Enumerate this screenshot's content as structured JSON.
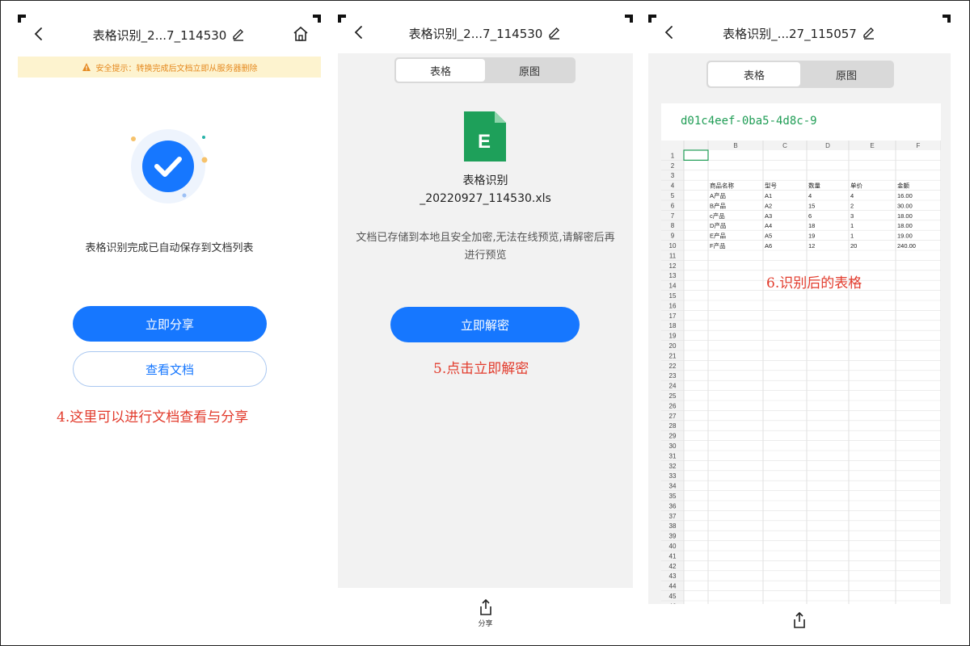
{
  "colors": {
    "accent": "#1677ff",
    "warning": "#e58a20",
    "warning_bg": "#fdf3cf",
    "annotation": "#e23b2c",
    "excel_green": "#1f9d55"
  },
  "panel1": {
    "title": "表格识别_2...7_114530",
    "warning": "安全提示：转换完成后文档立即从服务器删除",
    "success_text": "表格识别完成已自动保存到文档列表",
    "share_button": "立即分享",
    "view_button": "查看文档",
    "annotation": "4.这里可以进行文档查看与分享"
  },
  "panel2": {
    "title": "表格识别_2...7_114530",
    "tabs": [
      "表格",
      "原图"
    ],
    "file_icon_letter": "E",
    "file_name_line1": "表格识别",
    "file_name_line2": "_20220927_114530.xls",
    "encrypted_note": "文档已存储到本地且安全加密,无法在线预览,请解密后再进行预览",
    "decrypt_button": "立即解密",
    "annotation": "5.点击立即解密",
    "share_label": "分享"
  },
  "panel3": {
    "title": "表格识别_...27_115057",
    "tabs": [
      "表格",
      "原图"
    ],
    "sheet_name": "d01c4eef-0ba5-4d8c-9",
    "annotation": "6.识别后的表格",
    "columns": [
      "",
      "B",
      "C",
      "D",
      "E",
      "F"
    ],
    "row_count": 46,
    "rows": [
      {
        "row": 4,
        "cells": [
          "商品名称",
          "型号",
          "数量",
          "单价",
          "金额"
        ]
      },
      {
        "row": 5,
        "cells": [
          "A产品",
          "A1",
          "4",
          "4",
          "16.00"
        ]
      },
      {
        "row": 6,
        "cells": [
          "B产品",
          "A2",
          "15",
          "2",
          "30.00"
        ]
      },
      {
        "row": 7,
        "cells": [
          "c产品",
          "A3",
          "6",
          "3",
          "18.00"
        ]
      },
      {
        "row": 8,
        "cells": [
          "D产品",
          "A4",
          "18",
          "1",
          "18.00"
        ]
      },
      {
        "row": 9,
        "cells": [
          "E产品",
          "A5",
          "19",
          "1",
          "19.00"
        ]
      },
      {
        "row": 10,
        "cells": [
          "F产品",
          "A6",
          "12",
          "20",
          "240.00"
        ]
      }
    ]
  }
}
